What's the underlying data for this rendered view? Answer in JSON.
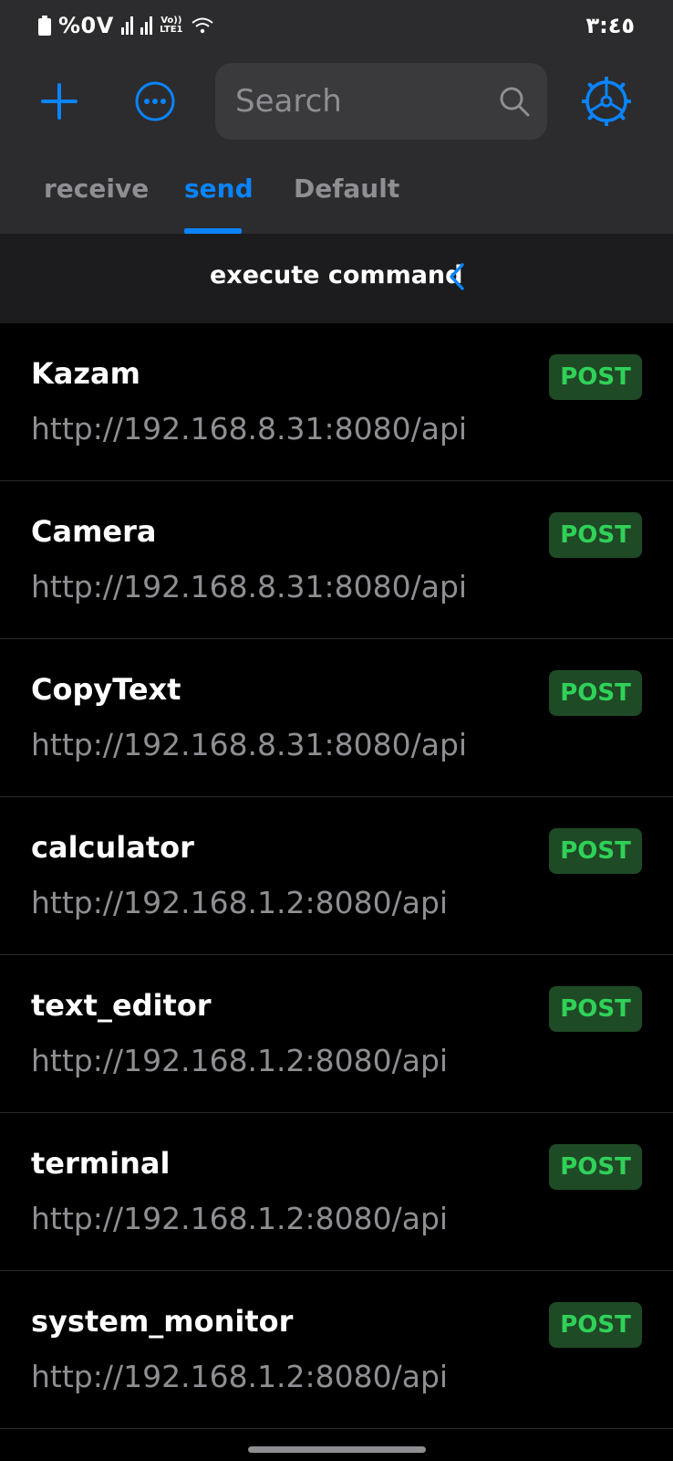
{
  "status_bar": {
    "battery": "%0V",
    "network": "Vo)) LTE1",
    "time": "٣:٤٥"
  },
  "toolbar": {
    "add_icon": "plus-icon",
    "more_icon": "more-icon",
    "search_placeholder": "Search",
    "settings_icon": "settings-icon"
  },
  "tabs": [
    {
      "label": "receive",
      "active": false
    },
    {
      "label": "send",
      "active": true
    },
    {
      "label": "Default",
      "active": false
    }
  ],
  "subbar": {
    "title": "execute command"
  },
  "requests": [
    {
      "name": "Kazam",
      "url": "http://192.168.8.31:8080/api",
      "method": "POST"
    },
    {
      "name": "Camera",
      "url": "http://192.168.8.31:8080/api",
      "method": "POST"
    },
    {
      "name": "CopyText",
      "url": "http://192.168.8.31:8080/api",
      "method": "POST"
    },
    {
      "name": "calculator",
      "url": "http://192.168.1.2:8080/api",
      "method": "POST"
    },
    {
      "name": "text_editor",
      "url": "http://192.168.1.2:8080/api",
      "method": "POST"
    },
    {
      "name": "terminal",
      "url": "http://192.168.1.2:8080/api",
      "method": "POST"
    },
    {
      "name": "system_monitor",
      "url": "http://192.168.1.2:8080/api",
      "method": "POST"
    }
  ],
  "colors": {
    "accent": "#0a84ff",
    "post_text": "#30d158",
    "post_bg": "#1f4a26",
    "header_bg": "#2c2c2e"
  }
}
